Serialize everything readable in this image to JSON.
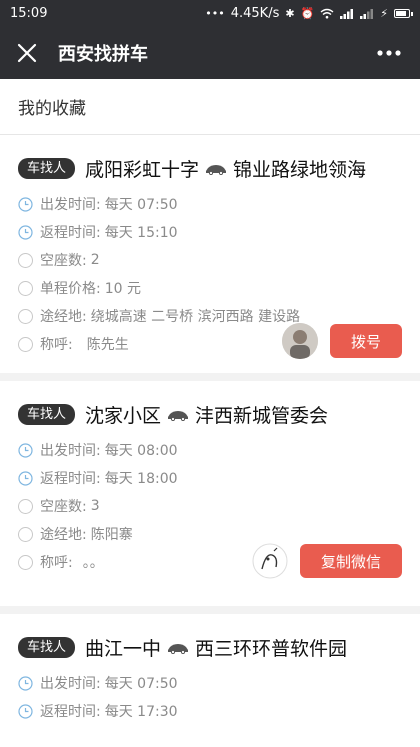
{
  "status": {
    "time": "15:09",
    "speed": "4.45K/s"
  },
  "nav": {
    "title": "西安找拼车"
  },
  "section": {
    "title": "我的收藏"
  },
  "cards": [
    {
      "tag": "车找人",
      "from": "咸阳彩虹十字",
      "to": "锦业路绿地领海",
      "rows": [
        {
          "label": "出发时间:",
          "value": "每天 07:50",
          "icon": "clock-icon"
        },
        {
          "label": "返程时间:",
          "value": "每天 15:10",
          "icon": "clock-icon"
        },
        {
          "label": "空座数:",
          "value": "2",
          "icon": "circle-icon"
        },
        {
          "label": "单程价格:",
          "value": "10 元",
          "icon": "circle-icon"
        },
        {
          "label": "途经地:",
          "value": "绕城高速 二号桥 滨河西路 建设路",
          "icon": "circle-icon"
        },
        {
          "label": "称呼:",
          "value": "陈先生",
          "icon": "circle-icon"
        }
      ],
      "button": "拨号"
    },
    {
      "tag": "车找人",
      "from": "沈家小区",
      "to": "沣西新城管委会",
      "rows": [
        {
          "label": "出发时间:",
          "value": "每天 08:00",
          "icon": "clock-icon"
        },
        {
          "label": "返程时间:",
          "value": "每天 18:00",
          "icon": "clock-icon"
        },
        {
          "label": "空座数:",
          "value": "3",
          "icon": "circle-icon"
        },
        {
          "label": "途经地:",
          "value": "陈阳寨",
          "icon": "circle-icon"
        },
        {
          "label": "称呼:",
          "value": "。。",
          "icon": "circle-icon"
        }
      ],
      "button": "复制微信"
    },
    {
      "tag": "车找人",
      "from": "曲江一中",
      "to": "西三环环普软件园",
      "rows": [
        {
          "label": "出发时间:",
          "value": "每天 07:50",
          "icon": "clock-icon"
        },
        {
          "label": "返程时间:",
          "value": "每天 17:30",
          "icon": "clock-icon"
        }
      ]
    }
  ],
  "colors": {
    "navbar": "#2e2f33",
    "button": "#e95c4f",
    "tag": "#333333",
    "clock": "#7fb6e0"
  }
}
